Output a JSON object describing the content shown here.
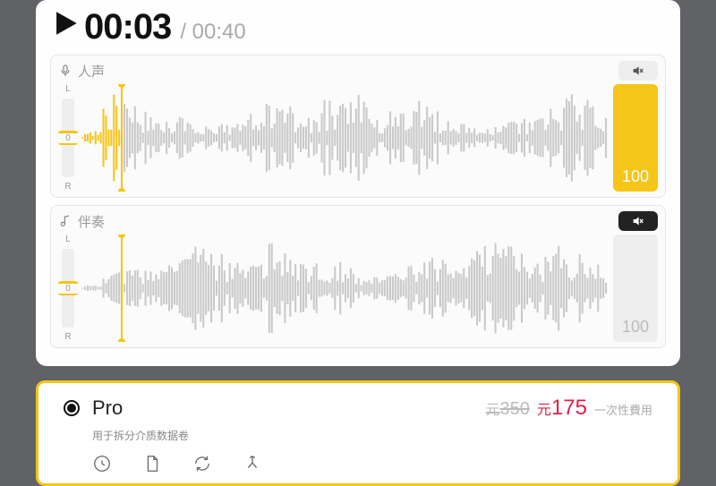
{
  "transport": {
    "current": "00:03",
    "duration": "/ 00:40",
    "playhead_pct": 7.5
  },
  "tracks": [
    {
      "id": "vocal",
      "label": "人声",
      "icon": "mic-icon",
      "mute_style": "light",
      "volume": 100,
      "vol_style": "active",
      "pan_labels": {
        "top": "L",
        "mid": "0",
        "bot": "R"
      }
    },
    {
      "id": "accomp",
      "label": "伴奏",
      "icon": "music-note-icon",
      "mute_style": "dark",
      "volume": 100,
      "vol_style": "muted",
      "pan_labels": {
        "top": "L",
        "mid": "0",
        "bot": "R"
      }
    }
  ],
  "pricing": {
    "plan": "Pro",
    "strike_currency": "元",
    "strike_value": "350",
    "now_currency": "元",
    "now_value": "175",
    "note": "一次性費用",
    "desc": "用于拆分介质数据卷"
  }
}
